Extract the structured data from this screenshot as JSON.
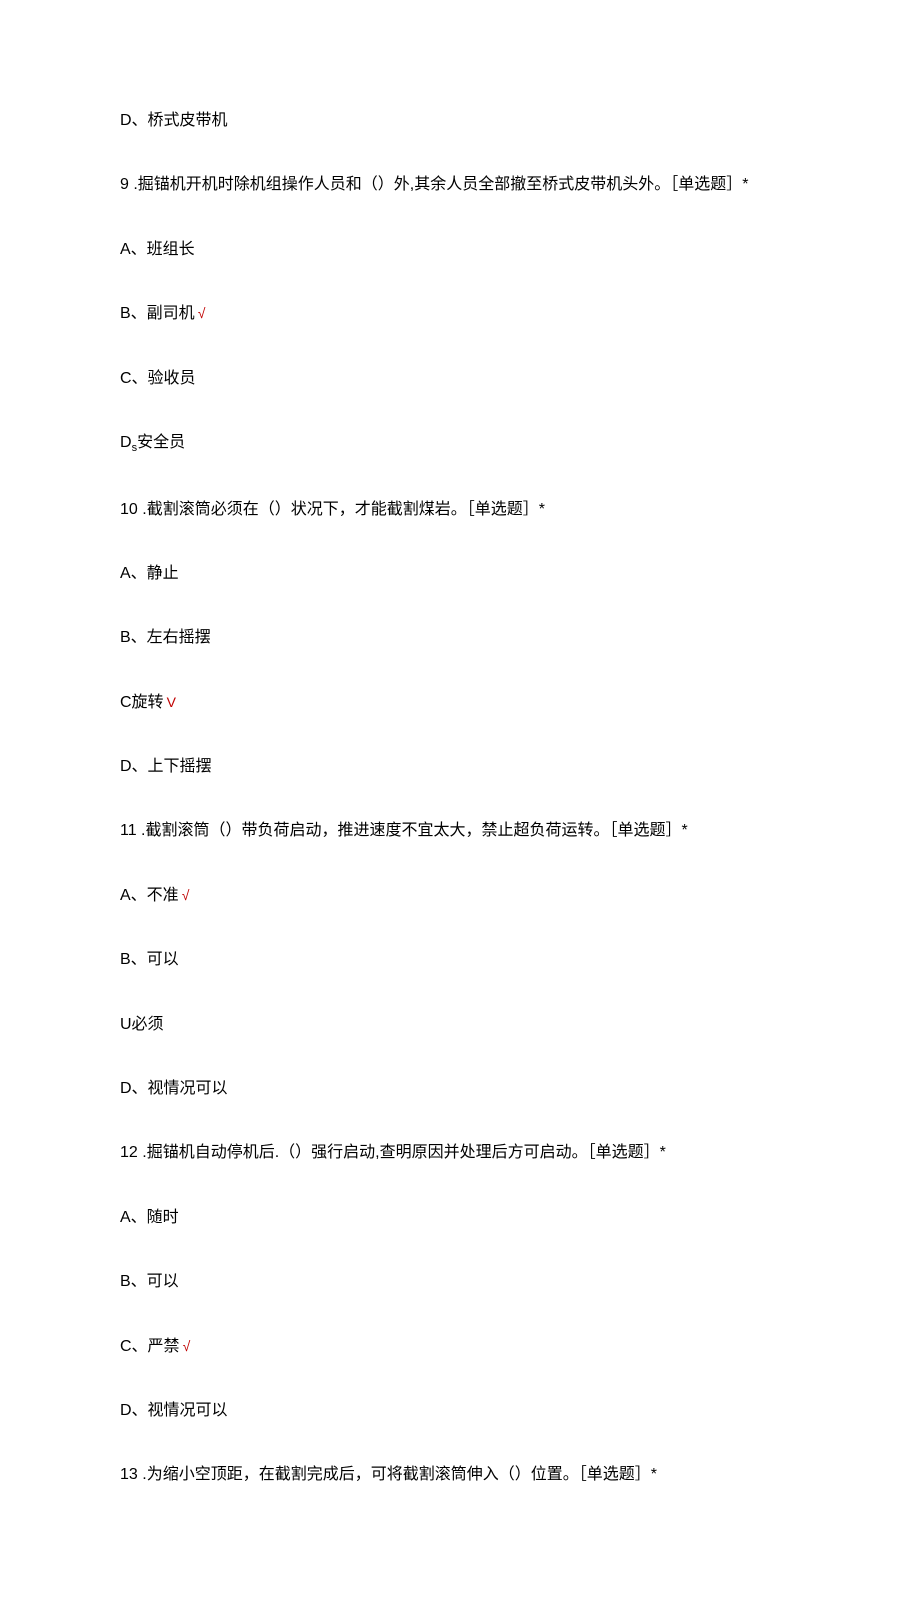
{
  "lines": [
    {
      "text": "D、桥式皮带机",
      "check": false
    },
    {
      "text": "9  .掘锚机开机时除机组操作人员和（）外,其余人员全部撤至桥式皮带机头外。［单选题］*",
      "check": false
    },
    {
      "text": "A、班组长",
      "check": false
    },
    {
      "text": "B、副司机",
      "check": true,
      "checkGlyph": "√"
    },
    {
      "text": "C、验收员",
      "check": false
    },
    {
      "text": "D",
      "sub": "s",
      "tail": "安全员",
      "check": false
    },
    {
      "text": "10   .截割滚筒必须在（）状况下，才能截割煤岩。［单选题］*",
      "check": false
    },
    {
      "text": "A、静止",
      "check": false
    },
    {
      "text": "B、左右摇摆",
      "check": false
    },
    {
      "text": "C旋转",
      "check": true,
      "checkGlyph": "V"
    },
    {
      "text": "D、上下摇摆",
      "check": false
    },
    {
      "text": "11   .截割滚筒（）带负荷启动，推进速度不宜太大，禁止超负荷运转。［单选题］*",
      "check": false
    },
    {
      "text": "A、不准",
      "check": true,
      "checkGlyph": "√"
    },
    {
      "text": "B、可以",
      "check": false
    },
    {
      "text": "U必须",
      "check": false
    },
    {
      "text": "D、视情况可以",
      "check": false
    },
    {
      "text": "12   .掘锚机自动停机后.（）强行启动,查明原因并处理后方可启动。［单选题］*",
      "check": false
    },
    {
      "text": "A、随时",
      "check": false
    },
    {
      "text": "B、可以",
      "check": false
    },
    {
      "text": "C、严禁",
      "check": true,
      "checkGlyph": "√"
    },
    {
      "text": "D、视情况可以",
      "check": false
    },
    {
      "text": "13   .为缩小空顶距，在截割完成后，可将截割滚筒伸入（）位置。［单选题］*",
      "check": false
    }
  ]
}
